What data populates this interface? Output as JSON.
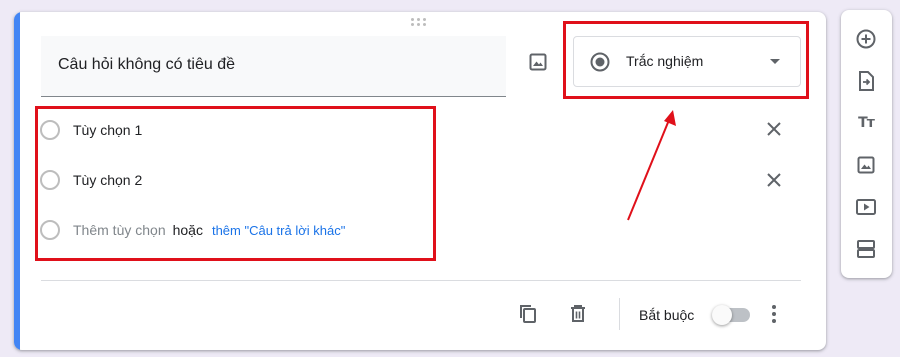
{
  "question": {
    "title": "Câu hỏi không có tiêu đề",
    "type_label": "Trắc nghiệm"
  },
  "options": [
    {
      "label": "Tùy chọn 1"
    },
    {
      "label": "Tùy chọn 2"
    }
  ],
  "add_option": {
    "label": "Thêm tùy chọn",
    "or": "hoặc",
    "other_link": "thêm \"Câu trả lời khác\""
  },
  "footer": {
    "required_label": "Bắt buộc",
    "required_on": false
  },
  "colors": {
    "accent": "#4285f4",
    "link": "#1a73e8",
    "annotation": "#e0101a"
  },
  "icons": {
    "image": "image-icon",
    "remove": "close-icon",
    "duplicate": "copy-icon",
    "delete": "trash-icon",
    "more": "more-vert-icon",
    "sidebar": [
      "add-circle-icon",
      "import-questions-icon",
      "title-text-icon",
      "image-icon",
      "video-icon",
      "section-icon"
    ]
  }
}
